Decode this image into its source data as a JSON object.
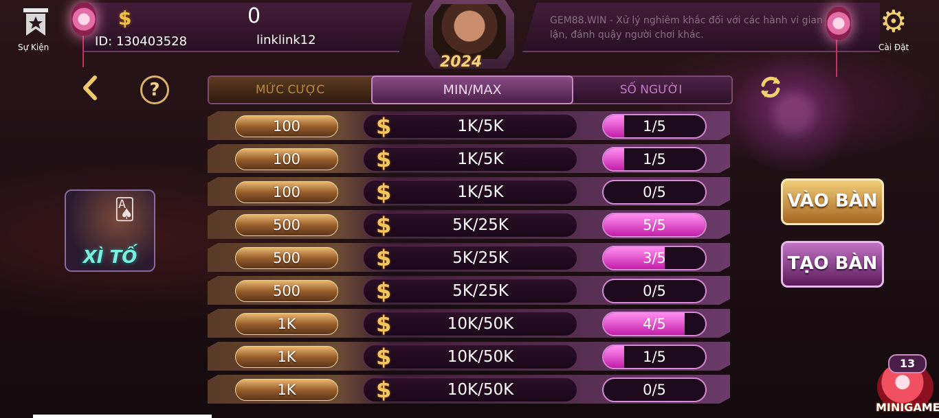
{
  "header": {
    "event_label": "Sự Kiện",
    "settings_label": "Cài Đặt",
    "balance": "0",
    "coin_symbol": "$",
    "player_id": "ID: 130403528",
    "player_name": "linklink12",
    "marquee": "GEM88.WIN - Xử lý nghiêm khắc đối với các hành vi gian lận, đánh quậy người chơi khác.",
    "year_badge": "2024"
  },
  "tabs": {
    "bet": "MỨC CƯỢC",
    "minmax": "MIN/MAX",
    "players": "SỐ NGƯỜI"
  },
  "rooms": [
    {
      "bet": "100",
      "minmax": "1K/5K",
      "players": "1/5",
      "fill": 0.2
    },
    {
      "bet": "100",
      "minmax": "1K/5K",
      "players": "1/5",
      "fill": 0.2
    },
    {
      "bet": "100",
      "minmax": "1K/5K",
      "players": "0/5",
      "fill": 0
    },
    {
      "bet": "500",
      "minmax": "5K/25K",
      "players": "5/5",
      "fill": 1
    },
    {
      "bet": "500",
      "minmax": "5K/25K",
      "players": "3/5",
      "fill": 0.6
    },
    {
      "bet": "500",
      "minmax": "5K/25K",
      "players": "0/5",
      "fill": 0
    },
    {
      "bet": "1K",
      "minmax": "10K/50K",
      "players": "4/5",
      "fill": 0.8
    },
    {
      "bet": "1K",
      "minmax": "10K/50K",
      "players": "1/5",
      "fill": 0.2
    },
    {
      "bet": "1K",
      "minmax": "10K/50K",
      "players": "0/5",
      "fill": 0
    }
  ],
  "actions": {
    "join": "VÀO BÀN",
    "create": "TẠO BÀN"
  },
  "game": {
    "title": "XÌ TỐ"
  },
  "minigame": {
    "count": "13",
    "label": "MINIGAME"
  },
  "icons": {
    "back": "chevron-left-icon",
    "help": "question-icon",
    "refresh": "refresh-icon",
    "settings": "gear-icon",
    "event": "star-icon",
    "coin": "dollar-icon"
  },
  "colors": {
    "gold": "#f2c96a",
    "pink_fill": "#c21ea8",
    "purple_bg": "#4e2348"
  }
}
